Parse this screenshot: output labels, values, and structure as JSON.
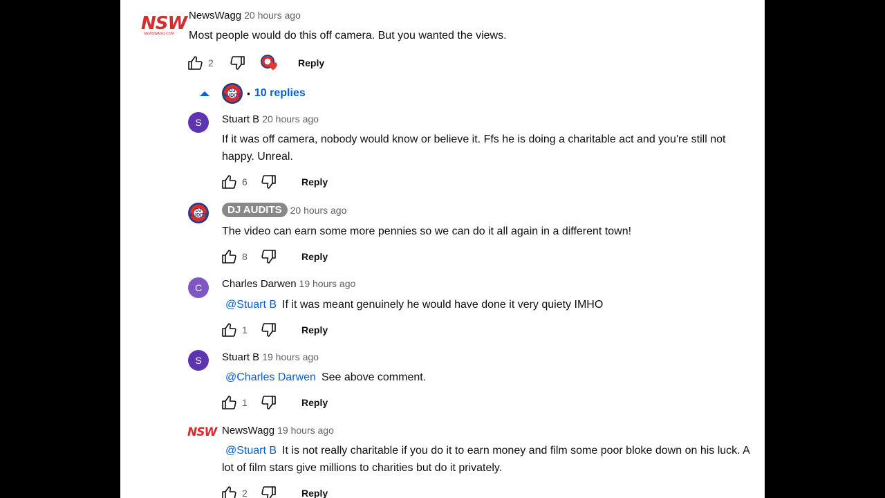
{
  "comments": [
    {
      "author": "NewsWagg",
      "time": "20 hours ago",
      "text": "Most people would do this off camera. But you wanted the views.",
      "likes": "2",
      "reply_label": "Reply",
      "avatar": "NSW"
    },
    {
      "author": "Stuart B",
      "time": "20 hours ago",
      "text": "If it was off camera, nobody would know or believe it. Ffs he is doing a charitable act and you're still not happy. Unreal.",
      "likes": "6",
      "reply_label": "Reply",
      "avatar": "S"
    },
    {
      "author": "DJ AUDITS",
      "time": "20 hours ago",
      "text": "The video can earn some more pennies so we can do it all again in a different town!",
      "likes": "8",
      "reply_label": "Reply",
      "avatar": "DJ AUDITS"
    },
    {
      "author": "Charles Darwen",
      "time": "19 hours ago",
      "mention": "@Stuart B",
      "text": "If it was meant genuinely he would have done it very quiety IMHO",
      "likes": "1",
      "reply_label": "Reply",
      "avatar": "C"
    },
    {
      "author": "Stuart B",
      "time": "19 hours ago",
      "mention": "@Charles Darwen",
      "text": "See above comment.",
      "likes": "1",
      "reply_label": "Reply",
      "avatar": "S"
    },
    {
      "author": "NewsWagg",
      "time": "19 hours ago",
      "mention": "@Stuart B",
      "text": "It is not really charitable if you do it to earn money and film some poor bloke down on his luck. A lot of film stars give millions to charities but do it privately.",
      "likes": "2",
      "reply_label": "Reply",
      "avatar": "NSW"
    }
  ],
  "replies_toggle": {
    "label": "10 replies",
    "separator": "•"
  },
  "logo_caption": "NEWSWAGG.COM",
  "colors": {
    "link": "#065fd4",
    "heart": "#e53935",
    "badge": "#888888"
  },
  "icons": [
    "like-icon",
    "dislike-icon",
    "heart-icon",
    "collapse-icon"
  ]
}
